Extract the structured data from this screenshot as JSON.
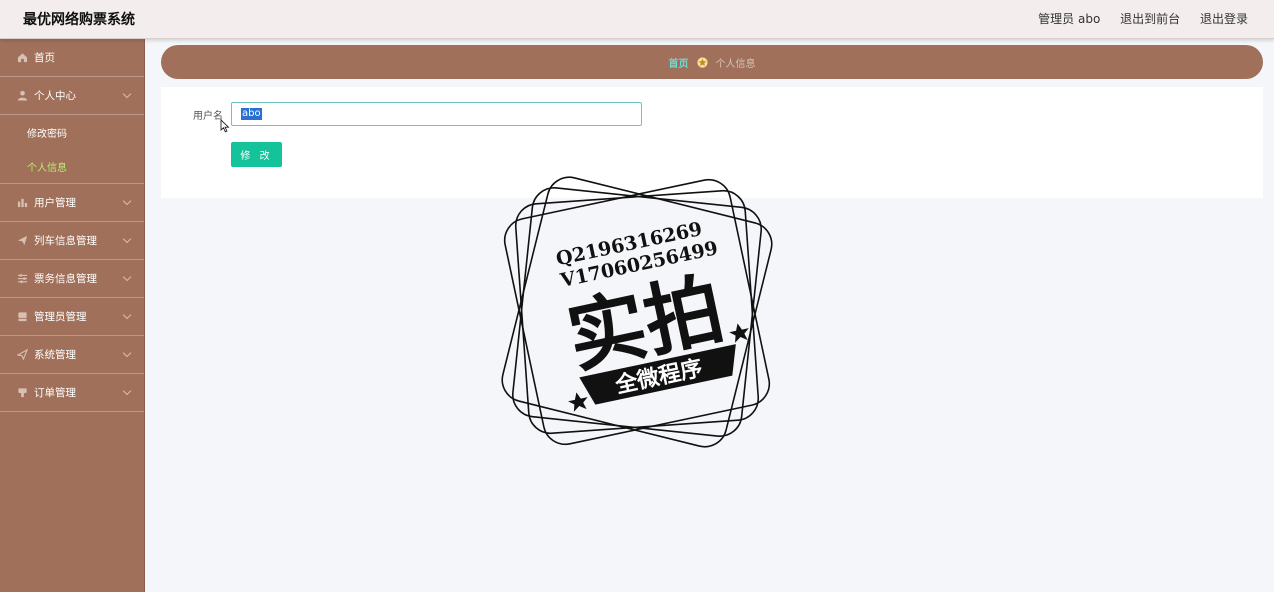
{
  "header": {
    "app_title": "最优网络购票系统",
    "admin_label": "管理员 abo",
    "to_frontend": "退出到前台",
    "logout": "退出登录"
  },
  "sidebar": {
    "home": "首页",
    "personal_center": "个人中心",
    "sub_change_password": "修改密码",
    "sub_personal_info": "个人信息",
    "user_mgmt": "用户管理",
    "train_mgmt": "列车信息管理",
    "ticket_mgmt": "票务信息管理",
    "admin_mgmt": "管理员管理",
    "system_mgmt": "系统管理",
    "order_mgmt": "订单管理"
  },
  "breadcrumb": {
    "home": "首页",
    "current": "个人信息"
  },
  "form": {
    "username_label": "用户名",
    "username_value": "abo",
    "submit_label": "修 改"
  },
  "watermark": {
    "line1": "Q2196316269",
    "line2": "V17060256499",
    "main": "实拍",
    "banner": "全微程序"
  },
  "colors": {
    "sidebar_bg": "#a0705a",
    "active_sub": "#b7f06a",
    "button": "#14c39a",
    "breadcrumb_home": "#66ddd6"
  }
}
